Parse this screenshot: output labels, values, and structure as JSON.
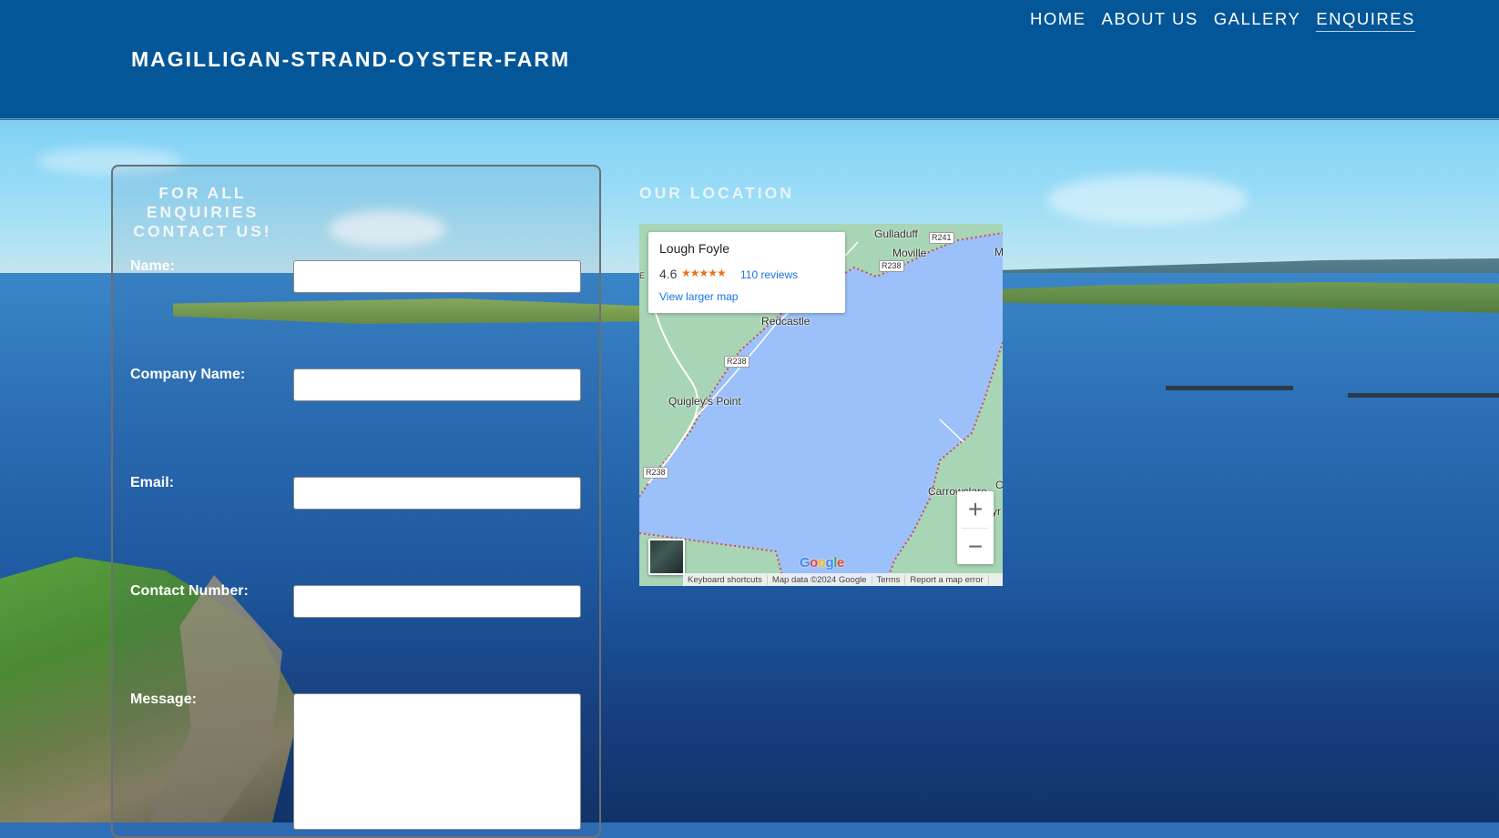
{
  "header": {
    "site_title": "MAGILLIGAN-STRAND-OYSTER-FARM",
    "nav": [
      "HOME",
      "ABOUT US",
      "GALLERY",
      "ENQUIRES"
    ],
    "active_nav": "ENQUIRES"
  },
  "form": {
    "heading": "FOR ALL ENQUIRIES CONTACT US!",
    "fields": [
      {
        "label": "Name:",
        "value": "",
        "placeholder": ""
      },
      {
        "label": "Company Name:",
        "value": "",
        "placeholder": ""
      },
      {
        "label": "Email:",
        "value": "",
        "placeholder": ""
      },
      {
        "label": "Contact Number:",
        "value": "",
        "placeholder": ""
      },
      {
        "label": "Message:",
        "value": "",
        "placeholder": ""
      }
    ]
  },
  "location": {
    "heading": "OUR LOCATION",
    "map": {
      "place_name": "Lough Foyle",
      "rating": "4.6",
      "stars": "★★★★★",
      "reviews": "110 reviews",
      "view_larger": "View larger map",
      "labels": {
        "gulladuff": "Gulladuff",
        "moville": "Moville",
        "redcastle": "Redcastle",
        "quigleys_point": "Quigley's Point",
        "carrowclare": "Carrowclare",
        "edge_m": "M",
        "edge_c": "C",
        "edge_yr": "yr",
        "edge_e": "E"
      },
      "roads": {
        "r241": "R241",
        "r238_a": "R238",
        "r238_b": "R238",
        "r238_c": "R238"
      },
      "zoom_in": "+",
      "zoom_out": "−",
      "google": "Google",
      "attribution": [
        "Keyboard shortcuts",
        "Map data ©2024 Google",
        "Terms",
        "Report a map error"
      ]
    }
  },
  "colors": {
    "header_bg": "#035698",
    "link_blue": "#1a73e8",
    "star_orange": "#e7711b",
    "water": "#9cc0f9",
    "land": "#a8d5b5"
  }
}
